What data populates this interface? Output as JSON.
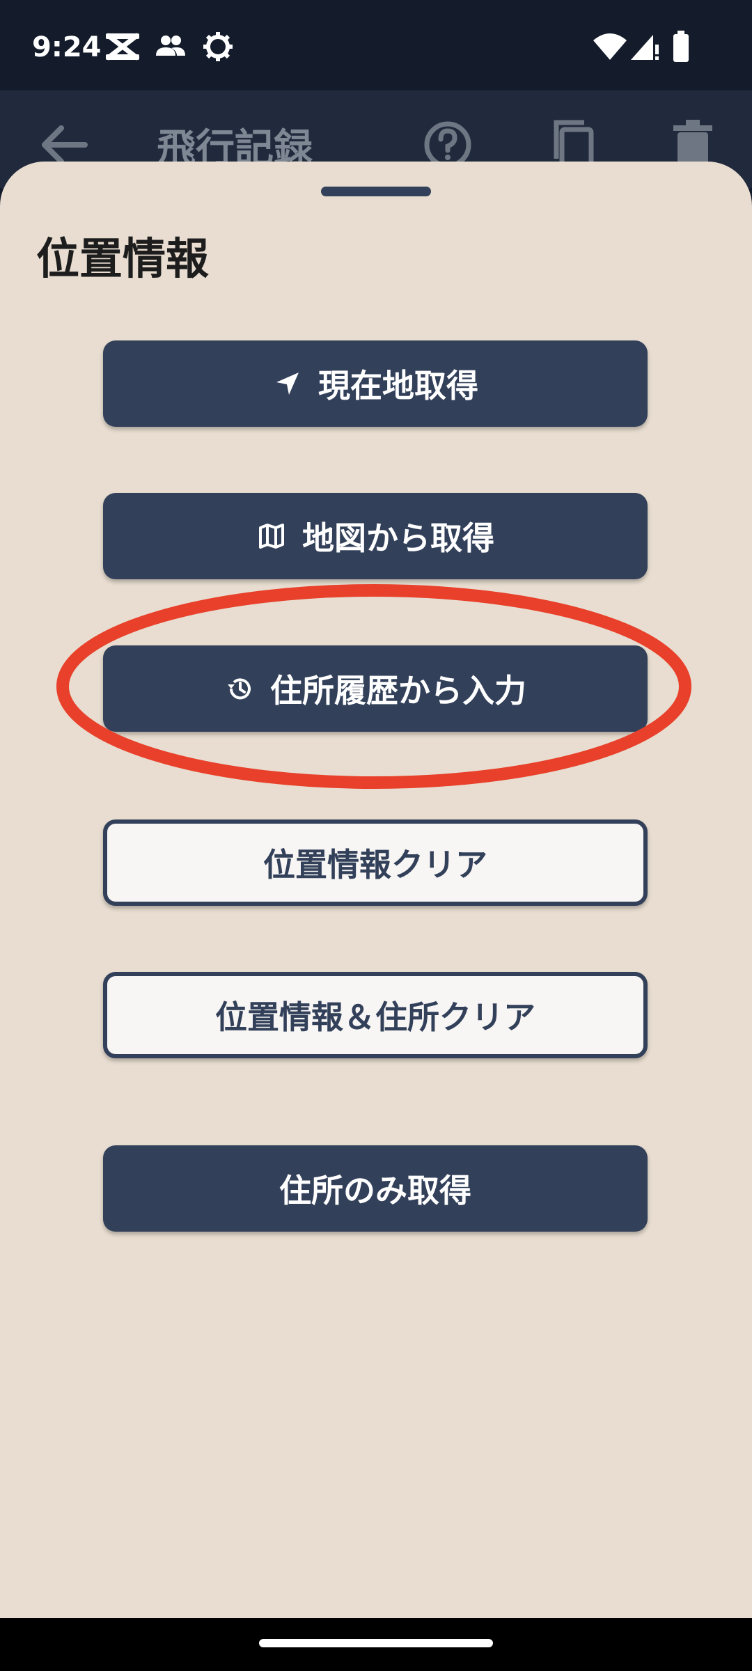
{
  "status_bar": {
    "time": "9:24"
  },
  "app_bar": {
    "title": "飛行記録"
  },
  "sheet": {
    "title": "位置情報",
    "buttons": {
      "current_location": "現在地取得",
      "from_map": "地図から取得",
      "from_history": "住所履歴から入力",
      "clear_location": "位置情報クリア",
      "clear_location_address": "位置情報＆住所クリア",
      "address_only": "住所のみ取得"
    }
  },
  "colors": {
    "sheet_background": "#e8ddd0",
    "button_primary": "#32405a",
    "annotation_red": "#e8402a"
  }
}
